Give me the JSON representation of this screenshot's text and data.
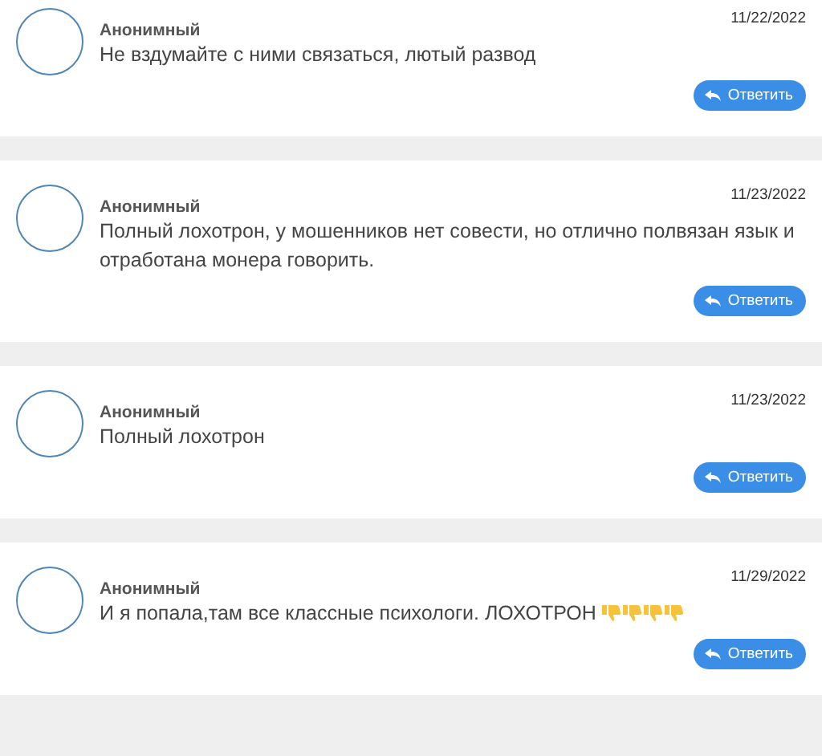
{
  "comments": [
    {
      "author": "Анонимный",
      "date": "11/22/2022",
      "text": "Не вздумайте с ними связаться, лютый развод",
      "reply_button": "Ответить"
    },
    {
      "author": "Анонимный",
      "date": "11/23/2022",
      "text": "Полный лохотрон, у мошенников нет совести, но отлично полвязан язык и отработана монера говорить.",
      "reply_button": "Ответить"
    },
    {
      "author": "Анонимный",
      "date": "11/23/2022",
      "text": "Полный лохотрон",
      "reply_button": "Ответить"
    },
    {
      "author": "Анонимный",
      "date": "11/29/2022",
      "text": "И я попала,там все классные психологи. ЛОХОТРОН",
      "emojis": [
        {
          "kind": "thumbs-down"
        },
        {
          "kind": "thumbs-down"
        },
        {
          "kind": "thumbs-down"
        },
        {
          "kind": "thumbs-down"
        }
      ],
      "reply_button": "Ответить"
    }
  ]
}
